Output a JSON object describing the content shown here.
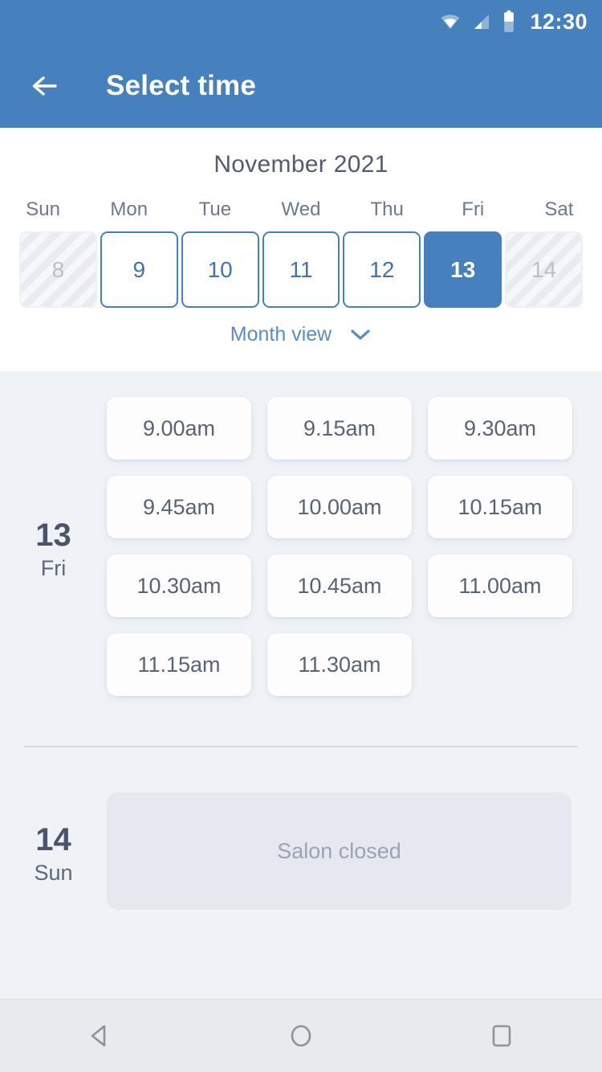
{
  "statusbar": {
    "time": "12:30",
    "icons": [
      "wifi-icon",
      "cellular-signal-icon",
      "battery-icon"
    ]
  },
  "appbar": {
    "title": "Select time",
    "back_icon": "arrow-left-icon"
  },
  "calendar": {
    "month_label": "November 2021",
    "weekdays": [
      "Sun",
      "Mon",
      "Tue",
      "Wed",
      "Thu",
      "Fri",
      "Sat"
    ],
    "days": [
      {
        "num": "8",
        "state": "disabled"
      },
      {
        "num": "9",
        "state": "enabled"
      },
      {
        "num": "10",
        "state": "enabled"
      },
      {
        "num": "11",
        "state": "enabled"
      },
      {
        "num": "12",
        "state": "enabled"
      },
      {
        "num": "13",
        "state": "selected"
      },
      {
        "num": "14",
        "state": "disabled"
      }
    ],
    "month_view_label": "Month view",
    "month_view_icon": "chevron-down-icon"
  },
  "day_groups": [
    {
      "day_num": "13",
      "day_dow": "Fri",
      "slots": [
        "9.00am",
        "9.15am",
        "9.30am",
        "9.45am",
        "10.00am",
        "10.15am",
        "10.30am",
        "10.45am",
        "11.00am",
        "11.15am",
        "11.30am"
      ]
    },
    {
      "day_num": "14",
      "day_dow": "Sun",
      "closed_label": "Salon closed"
    }
  ],
  "navbar": {
    "back_icon": "nav-back-triangle-icon",
    "home_icon": "nav-home-circle-icon",
    "recents_icon": "nav-recents-square-icon"
  },
  "colors": {
    "brand_blue": "#4680bd",
    "page_bg": "#eff2f7",
    "card_bg": "#fdfdfe",
    "text_dark": "#4a5568",
    "text_muted": "#9aa3b5",
    "closed_bg": "#e5e8ee",
    "navbar_bg": "#e8eaee"
  }
}
